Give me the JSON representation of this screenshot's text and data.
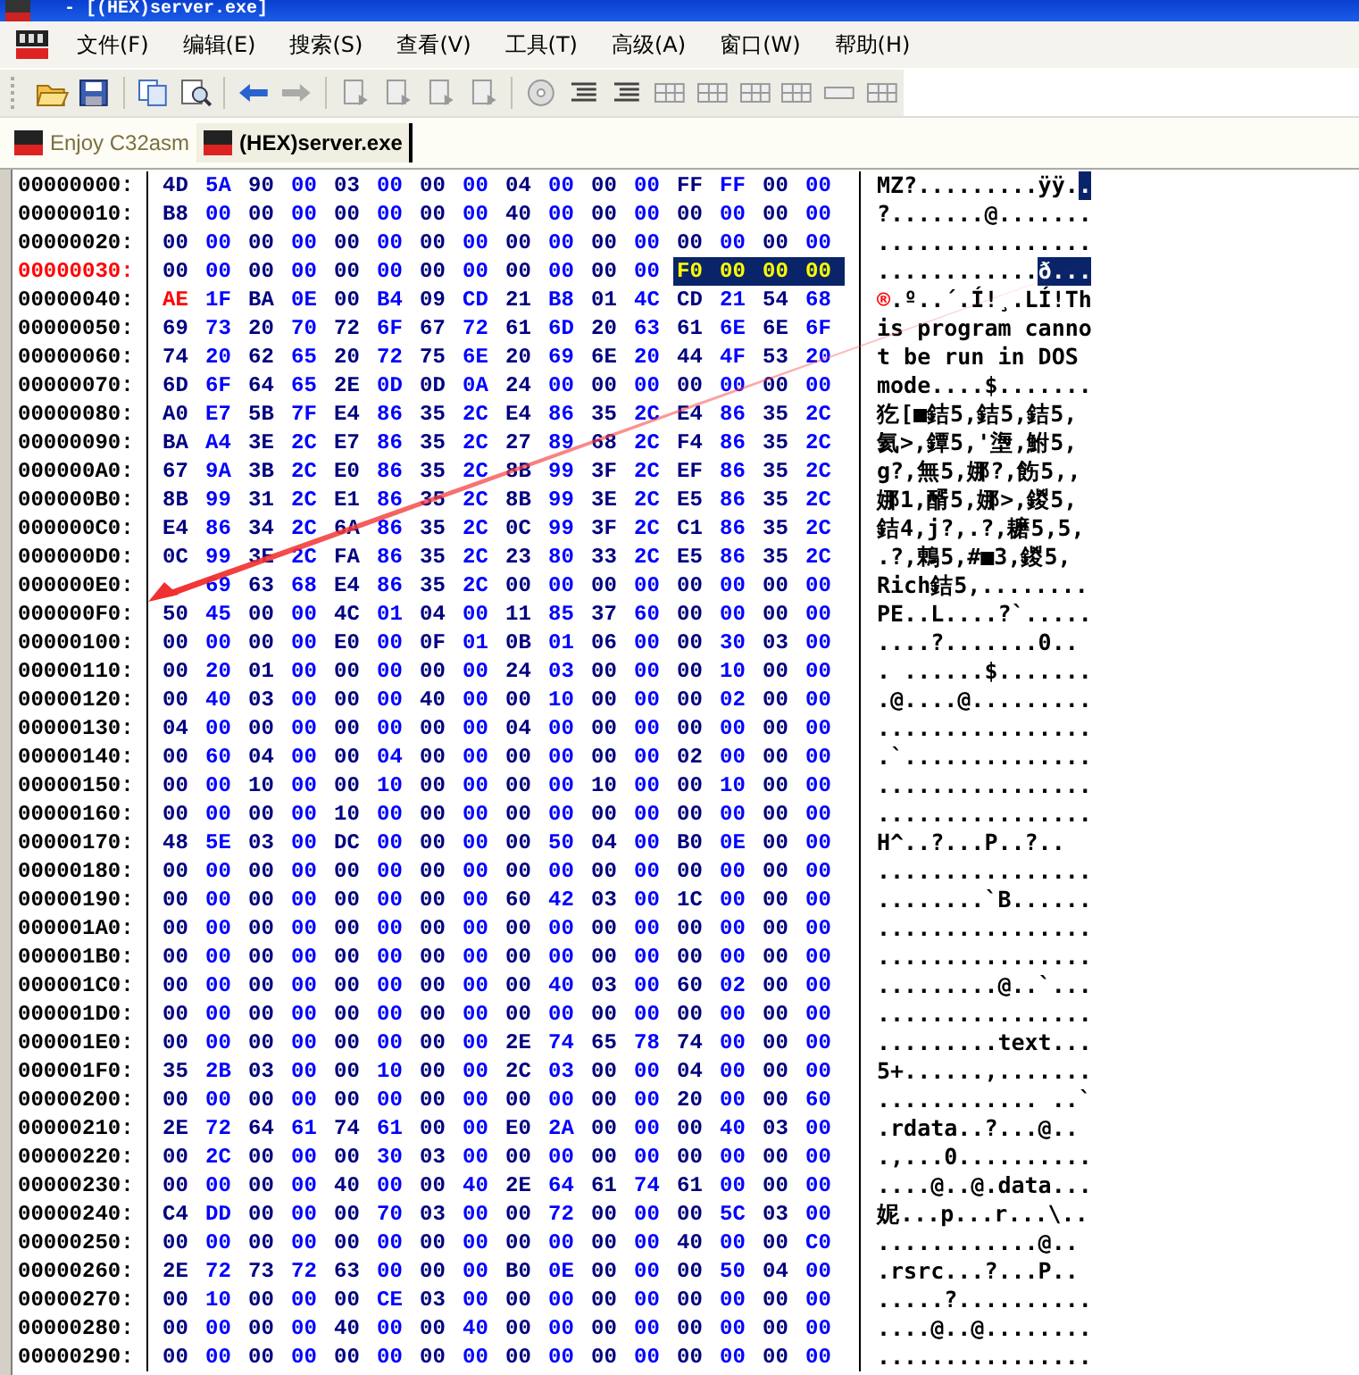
{
  "window": {
    "title": "- [(HEX)server.exe]"
  },
  "menu": [
    "文件(F)",
    "编辑(E)",
    "搜索(S)",
    "查看(V)",
    "工具(T)",
    "高级(A)",
    "窗口(W)",
    "帮助(H)"
  ],
  "tabs": [
    {
      "label": "Enjoy C32asm",
      "selected": false
    },
    {
      "label": "(HEX)server.exe",
      "selected": true
    }
  ],
  "rows": [
    {
      "offset": "00000000:",
      "selected": false,
      "bytes": [
        "4D",
        "5A",
        "90",
        "00",
        "03",
        "00",
        "00",
        "00",
        "04",
        "00",
        "00",
        "00",
        "FF",
        "FF",
        "00",
        "00"
      ],
      "ascii": "MZ?.........ÿÿ.",
      "ascii_selected": "."
    },
    {
      "offset": "00000010:",
      "selected": false,
      "bytes": [
        "B8",
        "00",
        "00",
        "00",
        "00",
        "00",
        "00",
        "00",
        "40",
        "00",
        "00",
        "00",
        "00",
        "00",
        "00",
        "00"
      ],
      "ascii": "?.......@......."
    },
    {
      "offset": "00000020:",
      "selected": false,
      "bytes": [
        "00",
        "00",
        "00",
        "00",
        "00",
        "00",
        "00",
        "00",
        "00",
        "00",
        "00",
        "00",
        "00",
        "00",
        "00",
        "00"
      ],
      "ascii": "................"
    },
    {
      "offset": "00000030:",
      "selected": true,
      "bytes": [
        "00",
        "00",
        "00",
        "00",
        "00",
        "00",
        "00",
        "00",
        "00",
        "00",
        "00",
        "00"
      ],
      "selected_bytes": [
        "F0",
        "00",
        "00",
        "00"
      ],
      "ascii": "............",
      "ascii_selected": "ð..."
    },
    {
      "offset": "00000040:",
      "selected": false,
      "cursor_byte": "AE",
      "bytes": [
        "1F",
        "BA",
        "0E",
        "00",
        "B4",
        "09",
        "CD",
        "21",
        "B8",
        "01",
        "4C",
        "CD",
        "21",
        "54",
        "68"
      ],
      "ascii_cursor": "®",
      "ascii": ".º..´.Í!¸.LÍ!Th"
    },
    {
      "offset": "00000050:",
      "selected": false,
      "bytes": [
        "69",
        "73",
        "20",
        "70",
        "72",
        "6F",
        "67",
        "72",
        "61",
        "6D",
        "20",
        "63",
        "61",
        "6E",
        "6E",
        "6F"
      ],
      "ascii": "is program canno"
    },
    {
      "offset": "00000060:",
      "selected": false,
      "bytes": [
        "74",
        "20",
        "62",
        "65",
        "20",
        "72",
        "75",
        "6E",
        "20",
        "69",
        "6E",
        "20",
        "44",
        "4F",
        "53",
        "20"
      ],
      "ascii": "t be run in DOS "
    },
    {
      "offset": "00000070:",
      "selected": false,
      "bytes": [
        "6D",
        "6F",
        "64",
        "65",
        "2E",
        "0D",
        "0D",
        "0A",
        "24",
        "00",
        "00",
        "00",
        "00",
        "00",
        "00",
        "00"
      ],
      "ascii": "mode....$......."
    },
    {
      "offset": "00000080:",
      "selected": false,
      "bytes": [
        "A0",
        "E7",
        "5B",
        "7F",
        "E4",
        "86",
        "35",
        "2C",
        "E4",
        "86",
        "35",
        "2C",
        "E4",
        "86",
        "35",
        "2C"
      ],
      "ascii": "犵[■銡5,銡5,銡5,"
    },
    {
      "offset": "00000090:",
      "selected": false,
      "bytes": [
        "BA",
        "A4",
        "3E",
        "2C",
        "E7",
        "86",
        "35",
        "2C",
        "27",
        "89",
        "68",
        "2C",
        "F4",
        "86",
        "35",
        "2C"
      ],
      "ascii": "氦>,鐔5,'塰,鮒5,"
    },
    {
      "offset": "000000A0:",
      "selected": false,
      "bytes": [
        "67",
        "9A",
        "3B",
        "2C",
        "E0",
        "86",
        "35",
        "2C",
        "8B",
        "99",
        "3F",
        "2C",
        "EF",
        "86",
        "35",
        "2C"
      ],
      "ascii": "g?,無5,娜?,飭5,,"
    },
    {
      "offset": "000000B0:",
      "selected": false,
      "bytes": [
        "8B",
        "99",
        "31",
        "2C",
        "E1",
        "86",
        "35",
        "2C",
        "8B",
        "99",
        "3E",
        "2C",
        "E5",
        "86",
        "35",
        "2C"
      ],
      "ascii": "娜1,醑5,娜>,鍐5,"
    },
    {
      "offset": "000000C0:",
      "selected": false,
      "bytes": [
        "E4",
        "86",
        "34",
        "2C",
        "6A",
        "86",
        "35",
        "2C",
        "0C",
        "99",
        "3F",
        "2C",
        "C1",
        "86",
        "35",
        "2C"
      ],
      "ascii": "銡4,j?,.?,耱5,5,"
    },
    {
      "offset": "000000D0:",
      "selected": false,
      "bytes": [
        "0C",
        "99",
        "3E",
        "2C",
        "FA",
        "86",
        "35",
        "2C",
        "23",
        "80",
        "33",
        "2C",
        "E5",
        "86",
        "35",
        "2C"
      ],
      "ascii": ".?,鶇5,#■3,鍐5,"
    },
    {
      "offset": "000000E0:",
      "selected": false,
      "first_hidden": true,
      "bytes": [
        "69",
        "63",
        "68",
        "E4",
        "86",
        "35",
        "2C",
        "00",
        "00",
        "00",
        "00",
        "00",
        "00",
        "00",
        "00"
      ],
      "ascii": "Rich銡5,........"
    },
    {
      "offset": "000000F0:",
      "selected": false,
      "bytes": [
        "50",
        "45",
        "00",
        "00",
        "4C",
        "01",
        "04",
        "00",
        "11",
        "85",
        "37",
        "60",
        "00",
        "00",
        "00",
        "00"
      ],
      "ascii": "PE..L....?`....."
    },
    {
      "offset": "00000100:",
      "selected": false,
      "bytes": [
        "00",
        "00",
        "00",
        "00",
        "E0",
        "00",
        "0F",
        "01",
        "0B",
        "01",
        "06",
        "00",
        "00",
        "30",
        "03",
        "00"
      ],
      "ascii": "....?.......0.."
    },
    {
      "offset": "00000110:",
      "selected": false,
      "bytes": [
        "00",
        "20",
        "01",
        "00",
        "00",
        "00",
        "00",
        "00",
        "24",
        "03",
        "00",
        "00",
        "00",
        "10",
        "00",
        "00"
      ],
      "ascii": ". ......$......."
    },
    {
      "offset": "00000120:",
      "selected": false,
      "bytes": [
        "00",
        "40",
        "03",
        "00",
        "00",
        "00",
        "40",
        "00",
        "00",
        "10",
        "00",
        "00",
        "00",
        "02",
        "00",
        "00"
      ],
      "ascii": ".@....@........."
    },
    {
      "offset": "00000130:",
      "selected": false,
      "bytes": [
        "04",
        "00",
        "00",
        "00",
        "00",
        "00",
        "00",
        "00",
        "04",
        "00",
        "00",
        "00",
        "00",
        "00",
        "00",
        "00"
      ],
      "ascii": "................"
    },
    {
      "offset": "00000140:",
      "selected": false,
      "bytes": [
        "00",
        "60",
        "04",
        "00",
        "00",
        "04",
        "00",
        "00",
        "00",
        "00",
        "00",
        "00",
        "02",
        "00",
        "00",
        "00"
      ],
      "ascii": ".`.............."
    },
    {
      "offset": "00000150:",
      "selected": false,
      "bytes": [
        "00",
        "00",
        "10",
        "00",
        "00",
        "10",
        "00",
        "00",
        "00",
        "00",
        "10",
        "00",
        "00",
        "10",
        "00",
        "00"
      ],
      "ascii": "................"
    },
    {
      "offset": "00000160:",
      "selected": false,
      "bytes": [
        "00",
        "00",
        "00",
        "00",
        "10",
        "00",
        "00",
        "00",
        "00",
        "00",
        "00",
        "00",
        "00",
        "00",
        "00",
        "00"
      ],
      "ascii": "................"
    },
    {
      "offset": "00000170:",
      "selected": false,
      "bytes": [
        "48",
        "5E",
        "03",
        "00",
        "DC",
        "00",
        "00",
        "00",
        "00",
        "50",
        "04",
        "00",
        "B0",
        "0E",
        "00",
        "00"
      ],
      "ascii": "H^..?...P..?.."
    },
    {
      "offset": "00000180:",
      "selected": false,
      "bytes": [
        "00",
        "00",
        "00",
        "00",
        "00",
        "00",
        "00",
        "00",
        "00",
        "00",
        "00",
        "00",
        "00",
        "00",
        "00",
        "00"
      ],
      "ascii": "................"
    },
    {
      "offset": "00000190:",
      "selected": false,
      "bytes": [
        "00",
        "00",
        "00",
        "00",
        "00",
        "00",
        "00",
        "00",
        "60",
        "42",
        "03",
        "00",
        "1C",
        "00",
        "00",
        "00"
      ],
      "ascii": "........`B......"
    },
    {
      "offset": "000001A0:",
      "selected": false,
      "bytes": [
        "00",
        "00",
        "00",
        "00",
        "00",
        "00",
        "00",
        "00",
        "00",
        "00",
        "00",
        "00",
        "00",
        "00",
        "00",
        "00"
      ],
      "ascii": "................"
    },
    {
      "offset": "000001B0:",
      "selected": false,
      "bytes": [
        "00",
        "00",
        "00",
        "00",
        "00",
        "00",
        "00",
        "00",
        "00",
        "00",
        "00",
        "00",
        "00",
        "00",
        "00",
        "00"
      ],
      "ascii": "................"
    },
    {
      "offset": "000001C0:",
      "selected": false,
      "bytes": [
        "00",
        "00",
        "00",
        "00",
        "00",
        "00",
        "00",
        "00",
        "00",
        "40",
        "03",
        "00",
        "60",
        "02",
        "00",
        "00"
      ],
      "ascii": ".........@..`..."
    },
    {
      "offset": "000001D0:",
      "selected": false,
      "bytes": [
        "00",
        "00",
        "00",
        "00",
        "00",
        "00",
        "00",
        "00",
        "00",
        "00",
        "00",
        "00",
        "00",
        "00",
        "00",
        "00"
      ],
      "ascii": "................"
    },
    {
      "offset": "000001E0:",
      "selected": false,
      "bytes": [
        "00",
        "00",
        "00",
        "00",
        "00",
        "00",
        "00",
        "00",
        "2E",
        "74",
        "65",
        "78",
        "74",
        "00",
        "00",
        "00"
      ],
      "ascii": ".........text..."
    },
    {
      "offset": "000001F0:",
      "selected": false,
      "bytes": [
        "35",
        "2B",
        "03",
        "00",
        "00",
        "10",
        "00",
        "00",
        "2C",
        "03",
        "00",
        "00",
        "04",
        "00",
        "00",
        "00"
      ],
      "ascii": "5+......,......."
    },
    {
      "offset": "00000200:",
      "selected": false,
      "bytes": [
        "00",
        "00",
        "00",
        "00",
        "00",
        "00",
        "00",
        "00",
        "00",
        "00",
        "00",
        "00",
        "20",
        "00",
        "00",
        "60"
      ],
      "ascii": "............ ..`"
    },
    {
      "offset": "00000210:",
      "selected": false,
      "bytes": [
        "2E",
        "72",
        "64",
        "61",
        "74",
        "61",
        "00",
        "00",
        "E0",
        "2A",
        "00",
        "00",
        "00",
        "40",
        "03",
        "00"
      ],
      "ascii": ".rdata..?...@.."
    },
    {
      "offset": "00000220:",
      "selected": false,
      "bytes": [
        "00",
        "2C",
        "00",
        "00",
        "00",
        "30",
        "03",
        "00",
        "00",
        "00",
        "00",
        "00",
        "00",
        "00",
        "00",
        "00"
      ],
      "ascii": ".,...0.........."
    },
    {
      "offset": "00000230:",
      "selected": false,
      "bytes": [
        "00",
        "00",
        "00",
        "00",
        "40",
        "00",
        "00",
        "40",
        "2E",
        "64",
        "61",
        "74",
        "61",
        "00",
        "00",
        "00"
      ],
      "ascii": "....@..@.data..."
    },
    {
      "offset": "00000240:",
      "selected": false,
      "bytes": [
        "C4",
        "DD",
        "00",
        "00",
        "00",
        "70",
        "03",
        "00",
        "00",
        "72",
        "00",
        "00",
        "00",
        "5C",
        "03",
        "00"
      ],
      "ascii": "妮...p...r...\\.."
    },
    {
      "offset": "00000250:",
      "selected": false,
      "bytes": [
        "00",
        "00",
        "00",
        "00",
        "00",
        "00",
        "00",
        "00",
        "00",
        "00",
        "00",
        "00",
        "40",
        "00",
        "00",
        "C0"
      ],
      "ascii": "............@.."
    },
    {
      "offset": "00000260:",
      "selected": false,
      "bytes": [
        "2E",
        "72",
        "73",
        "72",
        "63",
        "00",
        "00",
        "00",
        "B0",
        "0E",
        "00",
        "00",
        "00",
        "50",
        "04",
        "00"
      ],
      "ascii": ".rsrc...?...P.."
    },
    {
      "offset": "00000270:",
      "selected": false,
      "bytes": [
        "00",
        "10",
        "00",
        "00",
        "00",
        "CE",
        "03",
        "00",
        "00",
        "00",
        "00",
        "00",
        "00",
        "00",
        "00",
        "00"
      ],
      "ascii": ".....?.........."
    },
    {
      "offset": "00000280:",
      "selected": false,
      "bytes": [
        "00",
        "00",
        "00",
        "00",
        "40",
        "00",
        "00",
        "40",
        "00",
        "00",
        "00",
        "00",
        "00",
        "00",
        "00",
        "00"
      ],
      "ascii": "....@..@........"
    },
    {
      "offset": "00000290:",
      "selected": false,
      "bytes": [
        "00",
        "00",
        "00",
        "00",
        "00",
        "00",
        "00",
        "00",
        "00",
        "00",
        "00",
        "00",
        "00",
        "00",
        "00",
        "00"
      ],
      "ascii": "................"
    }
  ]
}
